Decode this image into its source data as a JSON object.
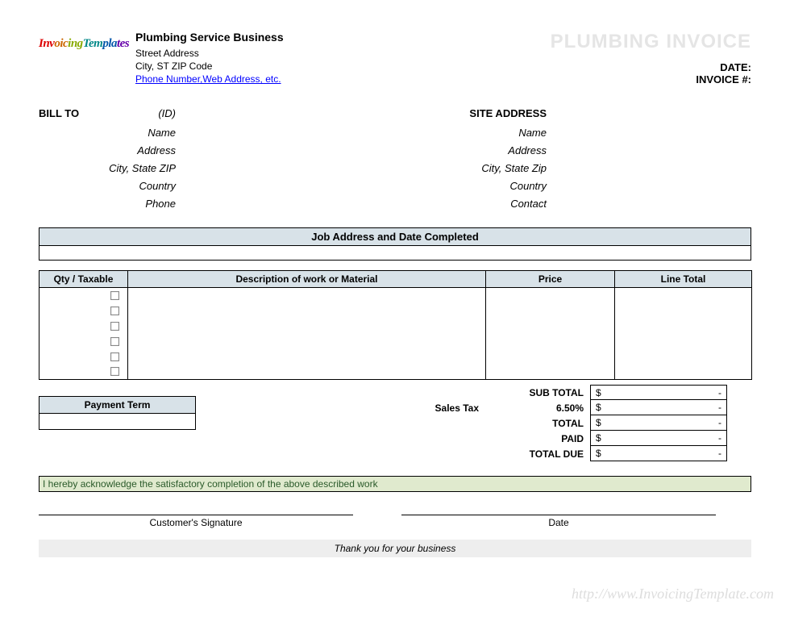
{
  "logo_text": "InvoicingTemplates",
  "business": {
    "name": "Plumbing Service Business",
    "street": "Street Address",
    "citystzip": "City, ST  ZIP Code",
    "contact_link": "Phone Number,Web Address, etc."
  },
  "doc_title": "PLUMBING INVOICE",
  "meta": {
    "date_label": "DATE:",
    "invoice_label": "INVOICE #:"
  },
  "billto": {
    "heading": "BILL TO",
    "id_label": "(ID)",
    "name": "Name",
    "address": "Address",
    "citystzip": "City, State ZIP",
    "country": "Country",
    "phone": "Phone"
  },
  "site": {
    "heading": "SITE ADDRESS",
    "name": "Name",
    "address": "Address",
    "citystzip": "City, State Zip",
    "country": "Country",
    "contact": "Contact"
  },
  "job_section": "Job Address and Date Completed",
  "columns": {
    "qty": "Qty / Taxable",
    "desc": "Description of work or Material",
    "price": "Price",
    "total": "Line Total"
  },
  "payment_term_label": "Payment Term",
  "sales_tax_label": "Sales Tax",
  "totals": {
    "subtotal": "SUB TOTAL",
    "tax_rate": "6.50%",
    "total": "TOTAL",
    "paid": "PAID",
    "due": "TOTAL DUE",
    "currency": "$",
    "dash": "-"
  },
  "ack_text": "I hereby acknowledge the satisfactory completion of the above described work",
  "sig": {
    "customer": "Customer's Signature",
    "date": "Date"
  },
  "thanks": "Thank you for your business",
  "watermark": "http://www.InvoicingTemplate.com"
}
